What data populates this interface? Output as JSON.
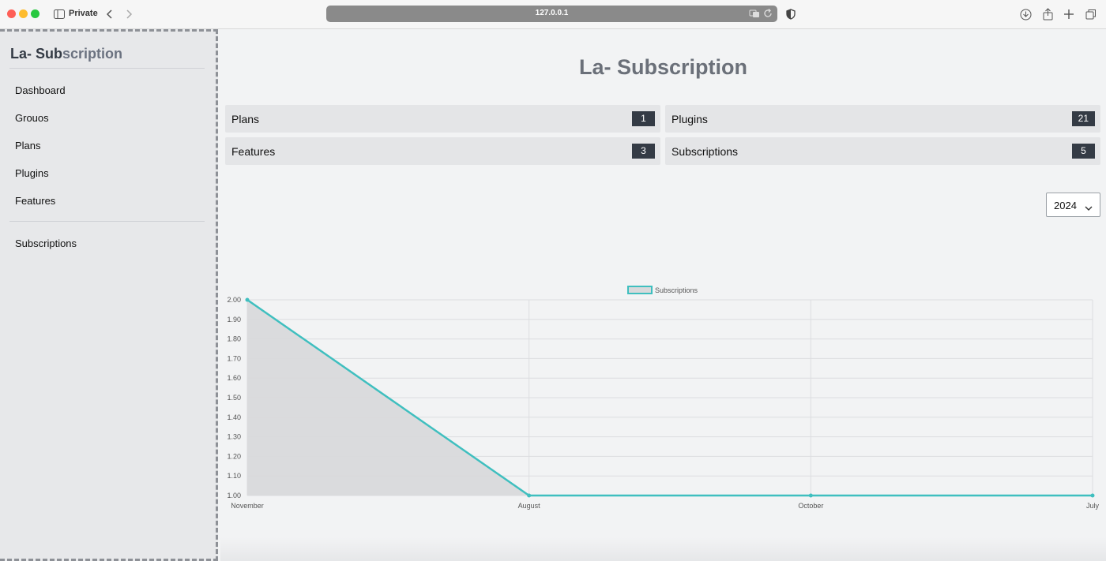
{
  "browser": {
    "private_label": "Private",
    "url": "127.0.0.1"
  },
  "sidebar": {
    "brand_strong": "La- Sub",
    "brand_muted": "scription",
    "items": [
      {
        "label": "Dashboard"
      },
      {
        "label": "Grouos"
      },
      {
        "label": "Plans"
      },
      {
        "label": "Plugins"
      },
      {
        "label": "Features"
      },
      {
        "label": "Subscriptions"
      }
    ]
  },
  "main": {
    "title": "La- Subscription",
    "cards": [
      {
        "label": "Plans",
        "count": "1"
      },
      {
        "label": "Plugins",
        "count": "21"
      },
      {
        "label": "Features",
        "count": "3"
      },
      {
        "label": "Subscriptions",
        "count": "5"
      }
    ],
    "year_select": {
      "value": "2024"
    }
  },
  "colors": {
    "line": "#3fbfbf",
    "fill": "#d8d9db",
    "badge": "#343b45"
  },
  "chart_data": {
    "type": "line",
    "title": "",
    "categories": [
      "November",
      "August",
      "October",
      "July"
    ],
    "series": [
      {
        "name": "Subscriptions",
        "values": [
          2,
          1,
          1,
          1
        ]
      }
    ],
    "ylim": [
      1,
      2
    ],
    "yticks": [
      "2.00",
      "1.90",
      "1.80",
      "1.70",
      "1.60",
      "1.50",
      "1.40",
      "1.30",
      "1.20",
      "1.10",
      "1.00"
    ],
    "grid": true,
    "legend": "top-center"
  }
}
